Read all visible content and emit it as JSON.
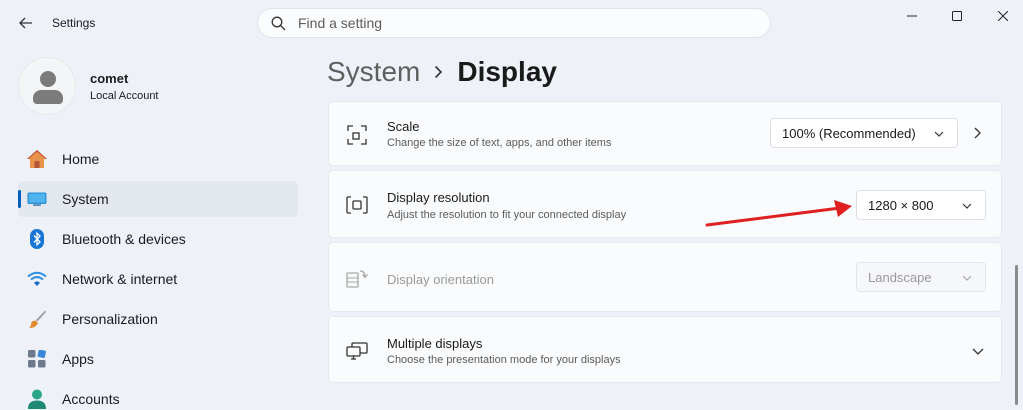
{
  "app": {
    "title": "Settings"
  },
  "search": {
    "placeholder": "Find a setting"
  },
  "profile": {
    "name": "comet",
    "account_type": "Local Account"
  },
  "nav": {
    "items": [
      {
        "label": "Home",
        "icon": "home-icon"
      },
      {
        "label": "System",
        "icon": "system-icon",
        "selected": true
      },
      {
        "label": "Bluetooth & devices",
        "icon": "bluetooth-icon"
      },
      {
        "label": "Network & internet",
        "icon": "wifi-icon"
      },
      {
        "label": "Personalization",
        "icon": "brush-icon"
      },
      {
        "label": "Apps",
        "icon": "apps-icon"
      },
      {
        "label": "Accounts",
        "icon": "accounts-icon"
      }
    ]
  },
  "breadcrumb": {
    "parent": "System",
    "current": "Display"
  },
  "settings": {
    "scale": {
      "title": "Scale",
      "description": "Change the size of text, apps, and other items",
      "value": "100% (Recommended)"
    },
    "resolution": {
      "title": "Display resolution",
      "description": "Adjust the resolution to fit your connected display",
      "value": "1280 × 800"
    },
    "orientation": {
      "title": "Display orientation",
      "value": "Landscape",
      "disabled": true
    },
    "multiple": {
      "title": "Multiple displays",
      "description": "Choose the presentation mode for your displays"
    }
  },
  "annotation": {
    "color": "#e02020",
    "points_to": "resolution-dropdown"
  },
  "colors": {
    "accent": "#005fb8",
    "background": "#eef2f8",
    "card": "#f9fbfd"
  }
}
